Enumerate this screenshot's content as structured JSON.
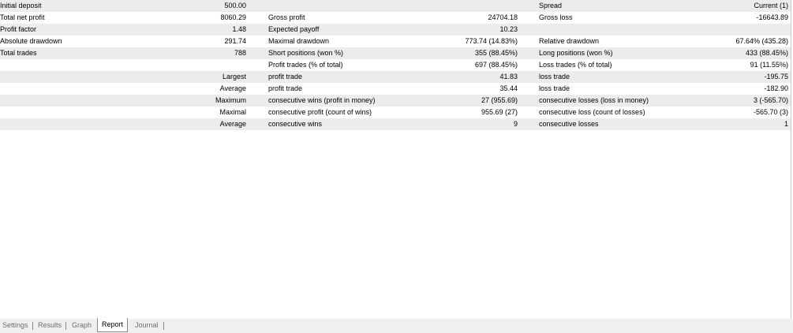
{
  "report": {
    "rows": [
      {
        "c0": "Initial deposit",
        "c1": "500.00",
        "c2": "",
        "c3": "",
        "c4": "Spread",
        "c5": "Current (1)"
      },
      {
        "c0": "Total net profit",
        "c1": "8060.29",
        "c2": "Gross profit",
        "c3": "24704.18",
        "c4": "Gross loss",
        "c5": "-16643.89"
      },
      {
        "c0": "Profit factor",
        "c1": "1.48",
        "c2": "Expected payoff",
        "c3": "10.23",
        "c4": "",
        "c5": ""
      },
      {
        "c0": "Absolute drawdown",
        "c1": "291.74",
        "c2": "Maximal drawdown",
        "c3": "773.74 (14.83%)",
        "c4": "Relative drawdown",
        "c5": "67.64% (435.28)"
      },
      {
        "c0": "Total trades",
        "c1": "788",
        "c2": "Short positions (won %)",
        "c3": "355 (88.45%)",
        "c4": "Long positions (won %)",
        "c5": "433 (88.45%)"
      },
      {
        "c0": "",
        "c1": "",
        "c2": "Profit trades (% of total)",
        "c3": "697 (88.45%)",
        "c4": "Loss trades (% of total)",
        "c5": "91 (11.55%)"
      },
      {
        "c0": "",
        "c1": "Largest",
        "c2": "profit trade",
        "c3": "41.83",
        "c4": "loss trade",
        "c5": "-195.75"
      },
      {
        "c0": "",
        "c1": "Average",
        "c2": "profit trade",
        "c3": "35.44",
        "c4": "loss trade",
        "c5": "-182.90"
      },
      {
        "c0": "",
        "c1": "Maximum",
        "c2": "consecutive wins (profit in money)",
        "c3": "27 (955.69)",
        "c4": "consecutive losses (loss in money)",
        "c5": "3 (-565.70)"
      },
      {
        "c0": "",
        "c1": "Maximal",
        "c2": "consecutive profit (count of wins)",
        "c3": "955.69 (27)",
        "c4": "consecutive loss (count of losses)",
        "c5": "-565.70 (3)"
      },
      {
        "c0": "",
        "c1": "Average",
        "c2": "consecutive wins",
        "c3": "9",
        "c4": "consecutive losses",
        "c5": "1"
      }
    ]
  },
  "tabs": {
    "settings": "Settings",
    "results": "Results",
    "graph": "Graph",
    "report": "Report",
    "journal": "Journal",
    "active": "Report"
  },
  "colors": {
    "row_shade": "#ececec",
    "tab_inactive_text": "#6d6d6d"
  }
}
